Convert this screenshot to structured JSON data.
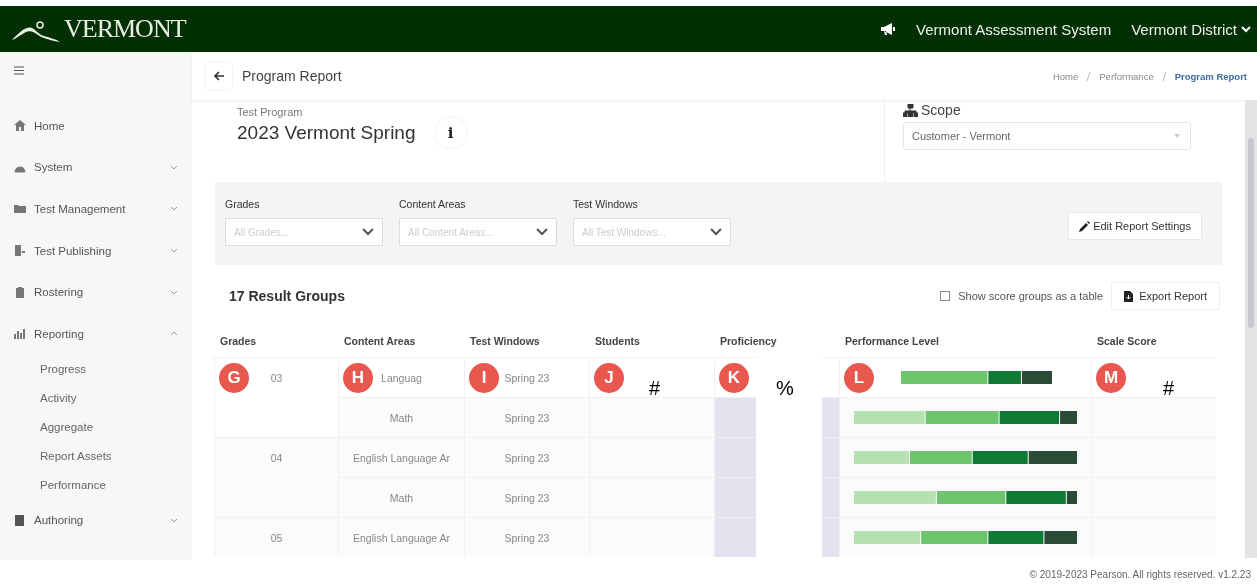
{
  "header": {
    "logo": "VERMONT",
    "app_title": "Vermont Assessment System",
    "district": "Vermont District"
  },
  "sidebar": {
    "items": [
      {
        "label": "Home"
      },
      {
        "label": "System",
        "expanded": false
      },
      {
        "label": "Test Management",
        "expanded": false
      },
      {
        "label": "Test Publishing",
        "expanded": false
      },
      {
        "label": "Rostering",
        "expanded": false
      },
      {
        "label": "Reporting",
        "expanded": true,
        "children": [
          {
            "label": "Progress"
          },
          {
            "label": "Activity"
          },
          {
            "label": "Aggregate"
          },
          {
            "label": "Report Assets"
          },
          {
            "label": "Performance"
          }
        ]
      },
      {
        "label": "Authoring",
        "expanded": false
      }
    ]
  },
  "page": {
    "title": "Program Report",
    "breadcrumbs": [
      {
        "label": "Home",
        "selected": false
      },
      {
        "label": "Performance",
        "selected": false
      },
      {
        "label": "Program Report",
        "selected": true
      }
    ]
  },
  "program": {
    "label": "Test Program",
    "value": "2023 Vermont Spring",
    "info": "i"
  },
  "scope": {
    "label": "Scope",
    "value": "Customer - Vermont"
  },
  "filters": [
    {
      "label": "Grades",
      "placeholder": "All Grades..."
    },
    {
      "label": "Content Areas",
      "placeholder": "All Content Areas..."
    },
    {
      "label": "Test Windows",
      "placeholder": "All Test Windows..."
    }
  ],
  "edit_button": "Edit Report Settings",
  "results": {
    "title": "17 Result Groups",
    "show_table": {
      "label": "Show score groups as a table",
      "checked": false
    },
    "export_button": "Export Report"
  },
  "table": {
    "columns": [
      {
        "label": "Grades",
        "callout": "G"
      },
      {
        "label": "Content Areas",
        "callout": "H"
      },
      {
        "label": "Test Windows",
        "callout": "I"
      },
      {
        "label": "Students",
        "callout": "J",
        "mark": "#"
      },
      {
        "label": "Proficiency",
        "callout": "K",
        "mark": "%"
      },
      {
        "label": "Performance Level",
        "callout": "L"
      },
      {
        "label": "Scale Score",
        "callout": "M",
        "mark": "#"
      }
    ],
    "groups": [
      {
        "grade": "03",
        "rows": [
          {
            "content_area": "Languag",
            "test_window": "Spring 23"
          },
          {
            "content_area": "Math",
            "test_window": "Spring 23"
          }
        ]
      },
      {
        "grade": "04",
        "rows": [
          {
            "content_area": "English Language Ar",
            "test_window": "Spring 23"
          },
          {
            "content_area": "Math",
            "test_window": "Spring 23"
          }
        ]
      },
      {
        "grade": "05",
        "rows": [
          {
            "content_area": "English Language Ar",
            "test_window": "Spring 23"
          }
        ]
      }
    ]
  },
  "footer": "© 2019-2023 Pearson. All rights reserved. v1.2.23"
}
